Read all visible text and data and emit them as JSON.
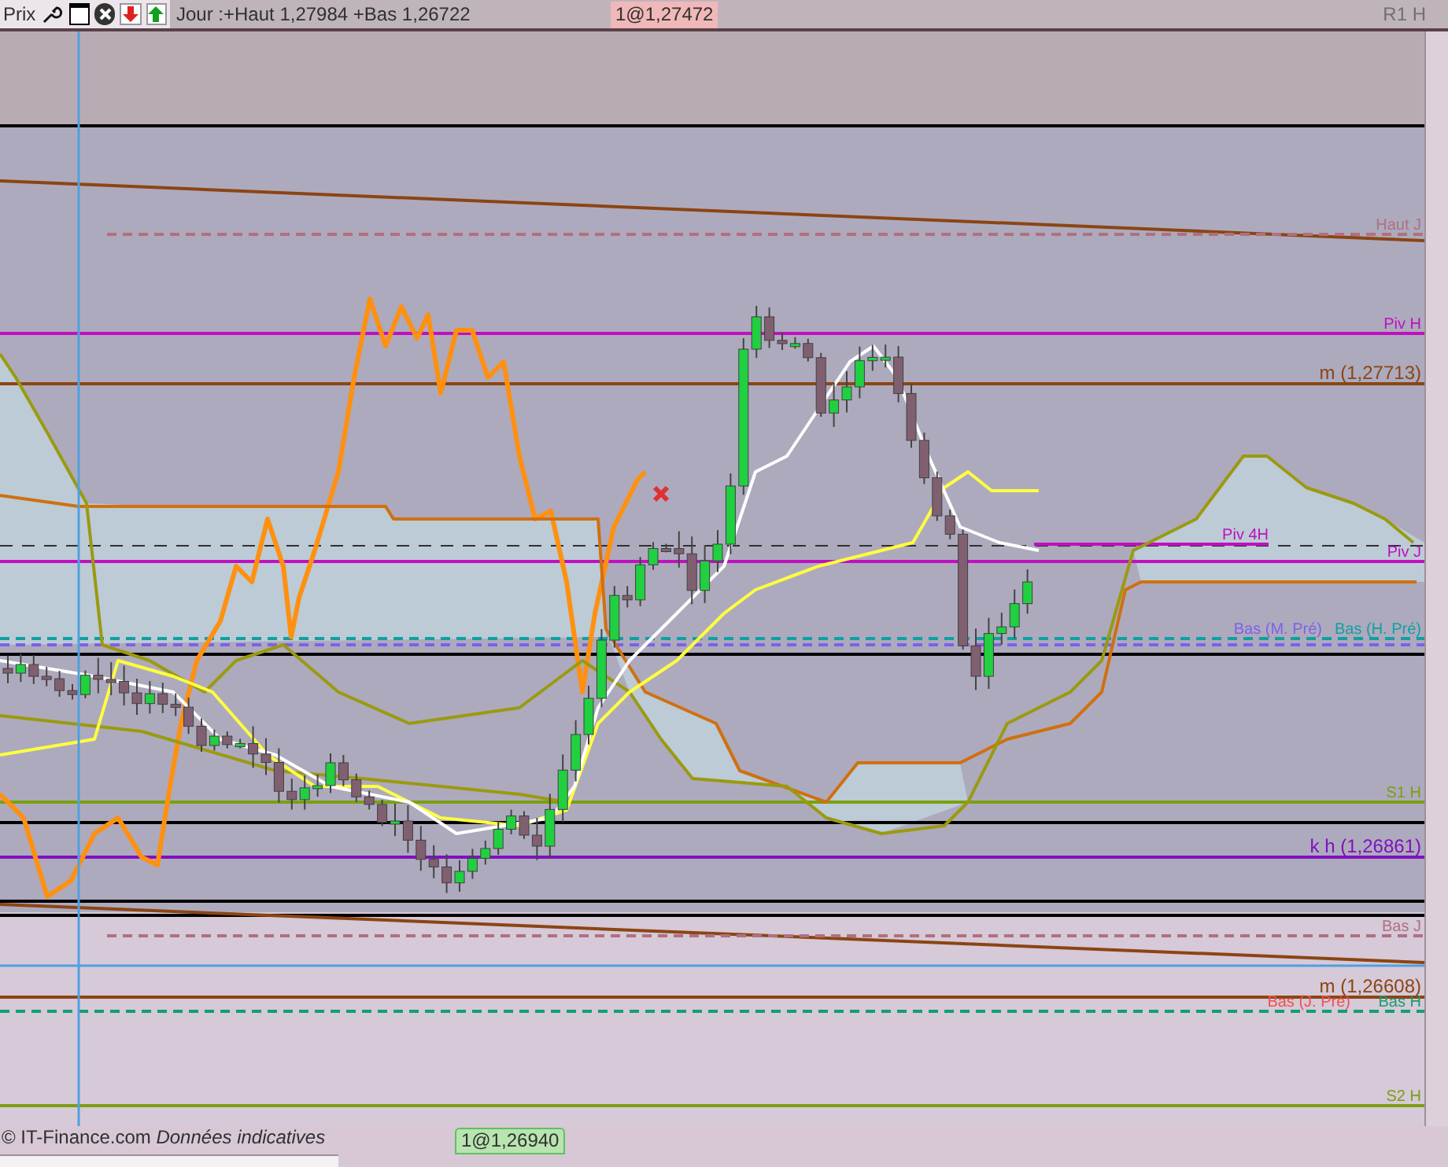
{
  "toolbar": {
    "label": "Prix",
    "summary": "Jour :+Haut 1,27984 +Bas 1,26722",
    "last_price": "1@1,27472",
    "top_level": "R1 H"
  },
  "levels": [
    {
      "label": "Haut J",
      "color": "#b07080",
      "kind": "dashed"
    },
    {
      "label": "Piv H",
      "color": "#c010c0",
      "kind": "solid"
    },
    {
      "label": "m (1,27713)",
      "color": "#8b4513",
      "kind": "solid"
    },
    {
      "label": "Piv 4H",
      "color": "#c010c0",
      "kind": "short"
    },
    {
      "label": "Piv J",
      "color": "#c010c0",
      "kind": "solid"
    },
    {
      "label": "Bas (H. Pré)",
      "color": "#10a0a0",
      "kind": "dashed"
    },
    {
      "label": "Bas (M. Pré)",
      "color": "#8060e8",
      "kind": "dashed"
    },
    {
      "label": "S1 H",
      "color": "#7aa010",
      "kind": "solid"
    },
    {
      "label": "k h (1,26861)",
      "color": "#8010c0",
      "kind": "solid"
    },
    {
      "label": "Bas J",
      "color": "#b07080",
      "kind": "dashed"
    },
    {
      "label": "m (1,26608)",
      "color": "#8b4513",
      "kind": "solid"
    },
    {
      "label": "Bas (J. Pré)",
      "color": "#f05050",
      "kind": "dashed"
    },
    {
      "label": "Bas H",
      "color": "#10a070",
      "kind": "dashed"
    },
    {
      "label": "S2 H",
      "color": "#7aa010",
      "kind": "solid"
    }
  ],
  "footer": {
    "credit": "© IT-Finance.com *Données indicatives*",
    "price_badge": "1@1,26940"
  }
}
